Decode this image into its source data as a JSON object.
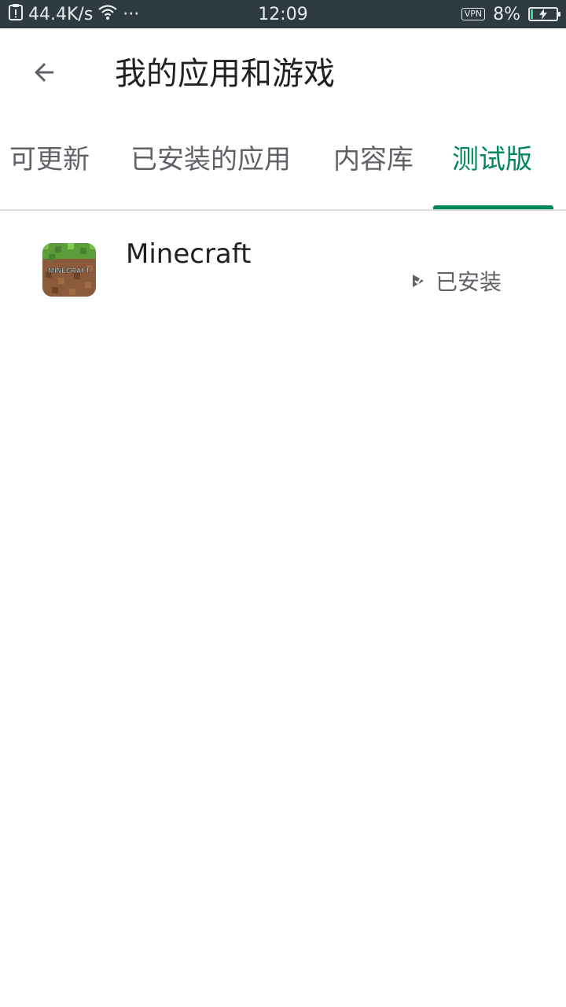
{
  "status_bar": {
    "network_speed": "44.4K/s",
    "more_dots": "···",
    "time": "12:09",
    "vpn": "VPN",
    "battery_percent": "8%",
    "battery_level": 0.08
  },
  "app_bar": {
    "title": "我的应用和游戏",
    "back_icon": "arrow-back-icon"
  },
  "tabs": [
    {
      "label": "可更新",
      "active": false
    },
    {
      "label": "已安装的应用",
      "active": false
    },
    {
      "label": "内容库",
      "active": false
    },
    {
      "label": "测试版",
      "active": true
    }
  ],
  "apps": [
    {
      "name": "Minecraft",
      "status": "已安装",
      "icon": "minecraft-grass-block-icon",
      "icon_text": "MINECRAFT"
    }
  ],
  "colors": {
    "accent": "#01875f",
    "status_bar_bg": "#2d3a40",
    "text_primary": "#202124",
    "text_secondary": "#5f6368"
  }
}
